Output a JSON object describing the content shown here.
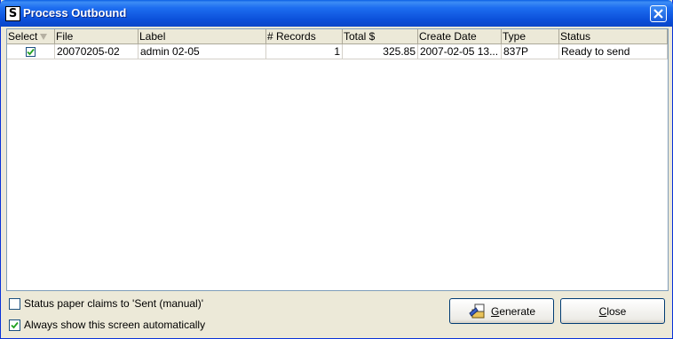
{
  "window": {
    "title": "Process Outbound"
  },
  "table": {
    "columns": [
      "Select",
      "File",
      "Label",
      "# Records",
      "Total $",
      "Create Date",
      "Type",
      "Status"
    ],
    "rows": [
      {
        "selected": true,
        "file": "20070205-02",
        "label": "admin 02-05",
        "records": "1",
        "total": "325.85",
        "create_date": "2007-02-05 13...",
        "type": "837P",
        "status": "Ready to send"
      }
    ]
  },
  "options": {
    "status_paper_label": "Status paper claims to 'Sent (manual)'",
    "status_paper_checked": false,
    "always_show_label": "Always show this screen automatically",
    "always_show_checked": true
  },
  "buttons": {
    "generate_mnemonic": "G",
    "generate_rest": "enerate",
    "close_mnemonic": "C",
    "close_rest": "lose"
  }
}
